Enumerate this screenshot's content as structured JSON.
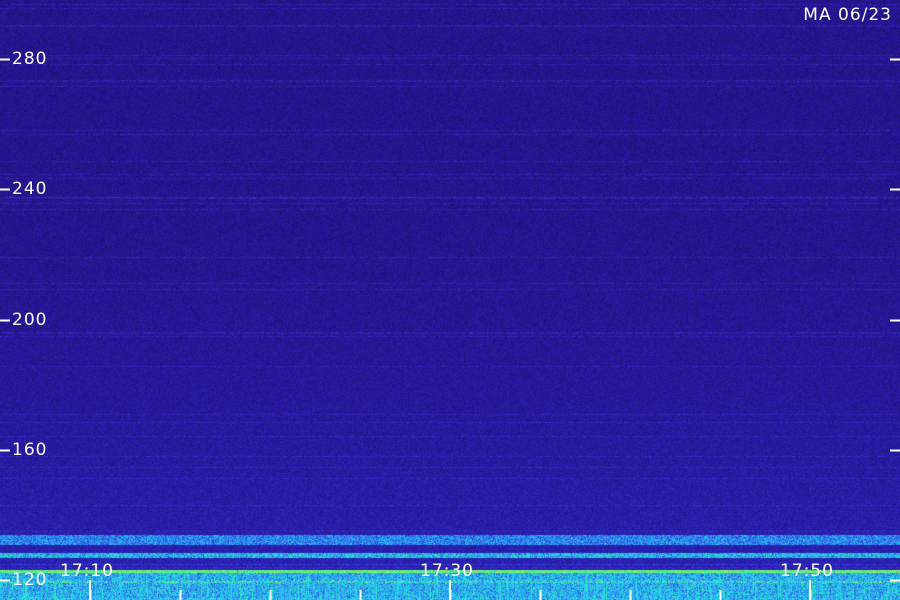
{
  "chart_data": {
    "type": "heatmap",
    "title": "",
    "corner_label": "MA 06/23",
    "xlabel": "",
    "ylabel": "",
    "y_ticks": [
      280,
      240,
      200,
      160,
      120
    ],
    "ylim": [
      114,
      298
    ],
    "x_tick_labels": [
      "17:10",
      "17:30",
      "17:50"
    ],
    "x_range": [
      "17:05",
      "17:55"
    ],
    "background_color": "#1e0f6e",
    "bands": [
      {
        "y_low": 114,
        "y_high": 123,
        "level": 0.55,
        "note": "noisy energy near bottom"
      },
      {
        "y_low": 122.3,
        "y_high": 123.3,
        "level": 0.95
      },
      {
        "y_low": 119.3,
        "y_high": 120.1,
        "level": 0.75
      },
      {
        "y_low": 127,
        "y_high": 128.5,
        "level": 0.6
      },
      {
        "y_low": 131,
        "y_high": 134,
        "level": 0.45
      }
    ],
    "palette": [
      "#1e0f6e",
      "#2a1ba8",
      "#2f3fe0",
      "#2e8ef0",
      "#27d6f0",
      "#3cf090",
      "#d8f030"
    ]
  }
}
